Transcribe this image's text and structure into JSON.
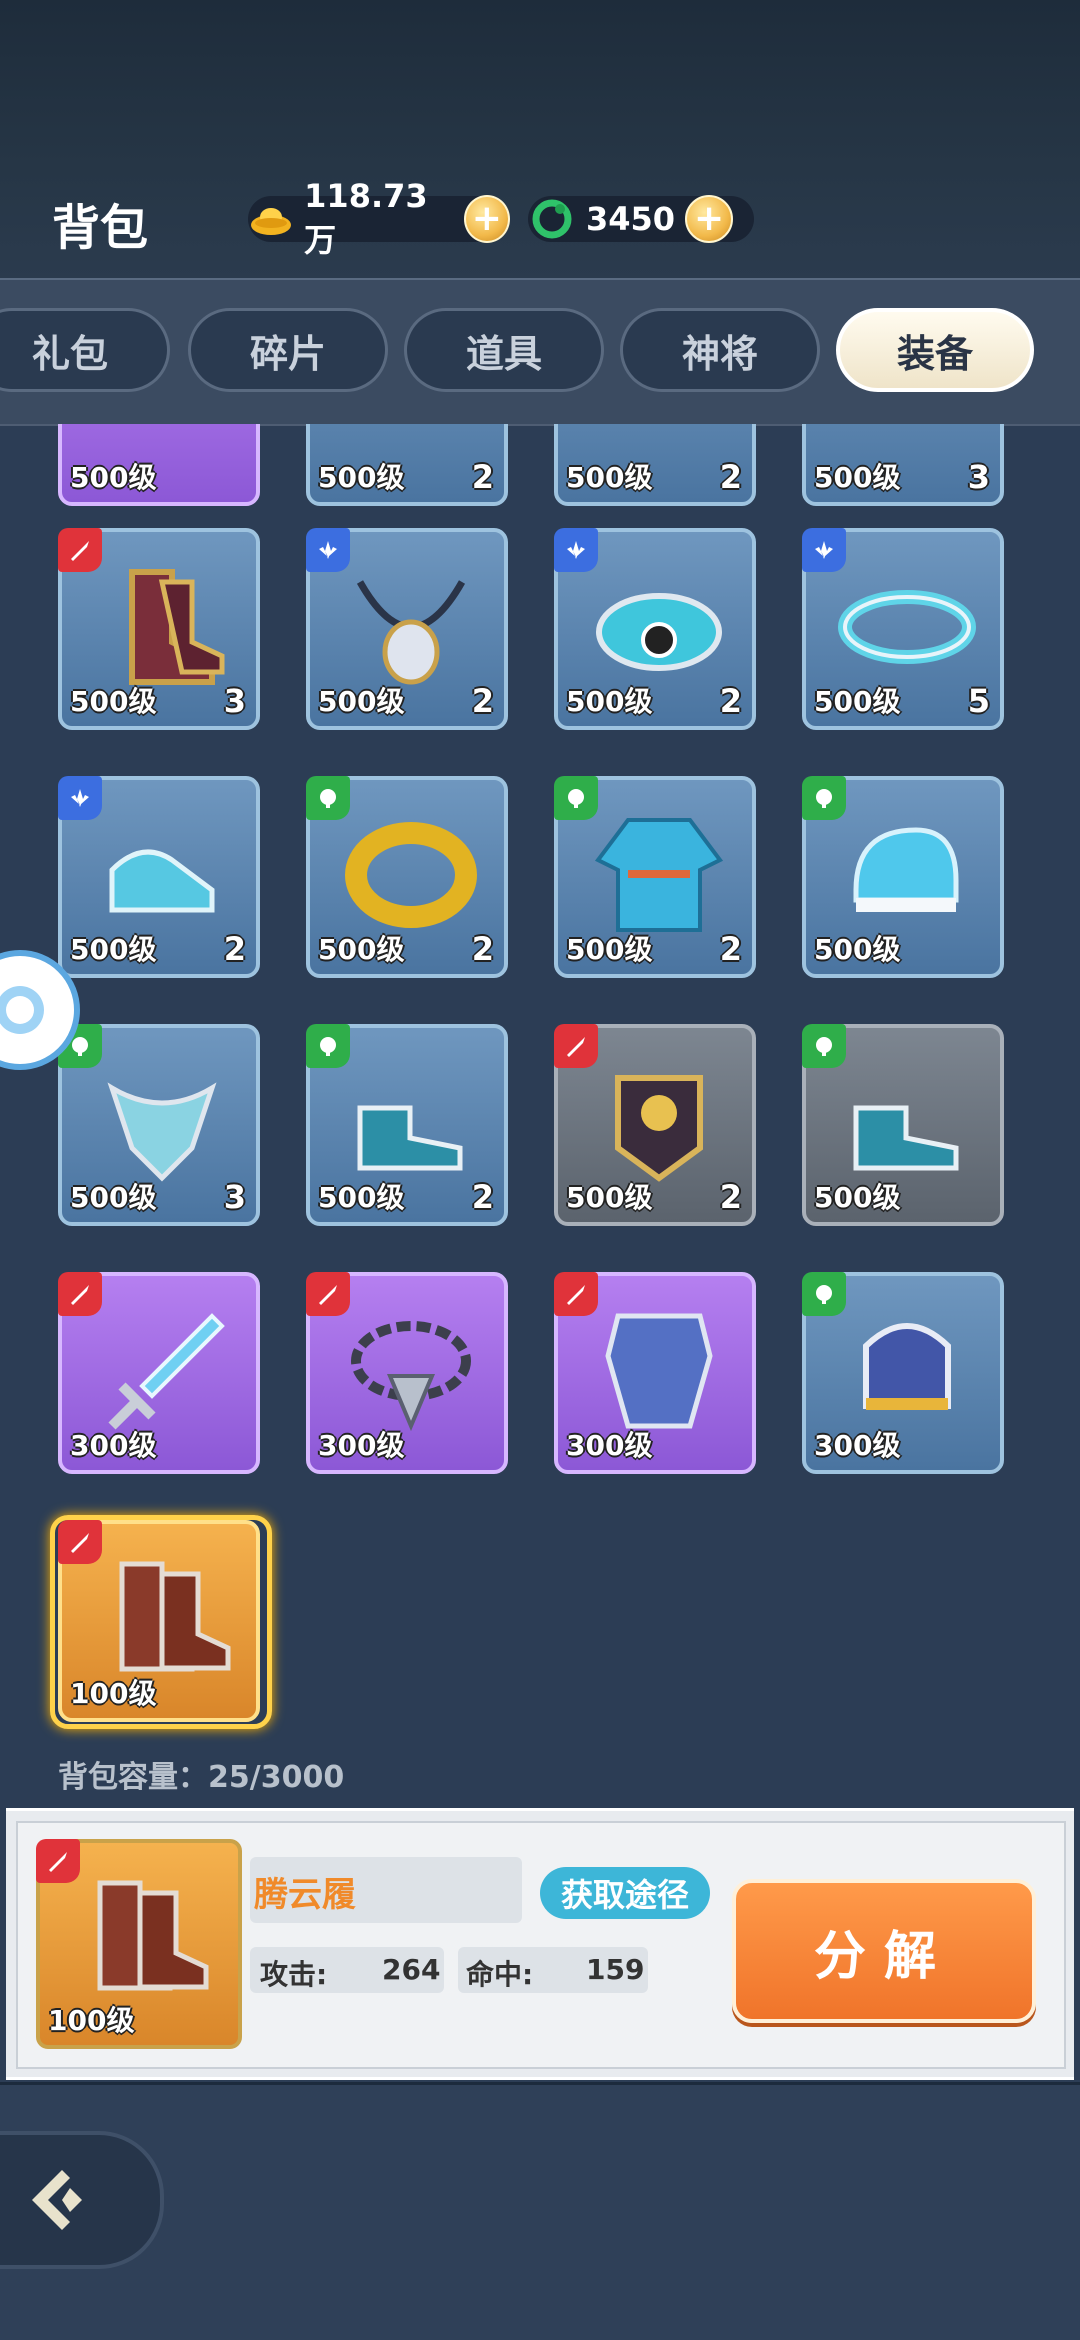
{
  "header": {
    "title": "背包",
    "gold_value": "118.73万",
    "jade_value": "3450"
  },
  "tabs": [
    {
      "label": "礼包",
      "active": false
    },
    {
      "label": "碎片",
      "active": false
    },
    {
      "label": "道具",
      "active": false
    },
    {
      "label": "神将",
      "active": false
    },
    {
      "label": "装备",
      "active": true
    }
  ],
  "grid": {
    "partial_row": [
      {
        "level": "500级",
        "count": "",
        "rarity": "purple"
      },
      {
        "level": "500级",
        "count": "2",
        "rarity": "blue"
      },
      {
        "level": "500级",
        "count": "2",
        "rarity": "blue"
      },
      {
        "level": "500级",
        "count": "3",
        "rarity": "blue"
      }
    ],
    "items": [
      {
        "level": "500级",
        "count": "3",
        "rarity": "blue",
        "badge": "red",
        "icon": "boots-icon"
      },
      {
        "level": "500级",
        "count": "2",
        "rarity": "blue",
        "badge": "blue",
        "icon": "necklace-icon"
      },
      {
        "level": "500级",
        "count": "2",
        "rarity": "blue",
        "badge": "blue",
        "icon": "belt-icon"
      },
      {
        "level": "500级",
        "count": "5",
        "rarity": "blue",
        "badge": "blue",
        "icon": "ring-belt-icon"
      },
      {
        "level": "500级",
        "count": "2",
        "rarity": "blue",
        "badge": "blue",
        "icon": "boots-icon"
      },
      {
        "level": "500级",
        "count": "2",
        "rarity": "blue",
        "badge": "green",
        "icon": "gold-ring-icon"
      },
      {
        "level": "500级",
        "count": "2",
        "rarity": "blue",
        "badge": "green",
        "icon": "robe-icon"
      },
      {
        "level": "500级",
        "count": "",
        "rarity": "blue",
        "badge": "green",
        "icon": "hat-icon"
      },
      {
        "level": "500级",
        "count": "3",
        "rarity": "blue",
        "badge": "green",
        "icon": "chain-icon"
      },
      {
        "level": "500级",
        "count": "2",
        "rarity": "blue",
        "badge": "green",
        "icon": "boots-icon"
      },
      {
        "level": "500级",
        "count": "2",
        "rarity": "gray",
        "badge": "red",
        "icon": "armor-icon"
      },
      {
        "level": "500级",
        "count": "",
        "rarity": "gray",
        "badge": "green",
        "icon": "boots-icon"
      },
      {
        "level": "300级",
        "count": "",
        "rarity": "purple",
        "badge": "red",
        "icon": "sword-icon"
      },
      {
        "level": "300级",
        "count": "",
        "rarity": "purple",
        "badge": "red",
        "icon": "chain-icon"
      },
      {
        "level": "300级",
        "count": "",
        "rarity": "purple",
        "badge": "red",
        "icon": "armor-icon"
      },
      {
        "level": "300级",
        "count": "",
        "rarity": "blue",
        "badge": "green",
        "icon": "hat-icon"
      },
      {
        "level": "100级",
        "count": "",
        "rarity": "orange",
        "badge": "red",
        "icon": "boots-icon"
      }
    ]
  },
  "capacity_label": "背包容量：25/3000",
  "detail": {
    "level": "100级",
    "name": "腾云履",
    "source_button": "获取途径",
    "attack_label": "攻击:",
    "attack_value": "264",
    "hit_label": "命中:",
    "hit_value": "159",
    "decompose_button": "分解"
  }
}
